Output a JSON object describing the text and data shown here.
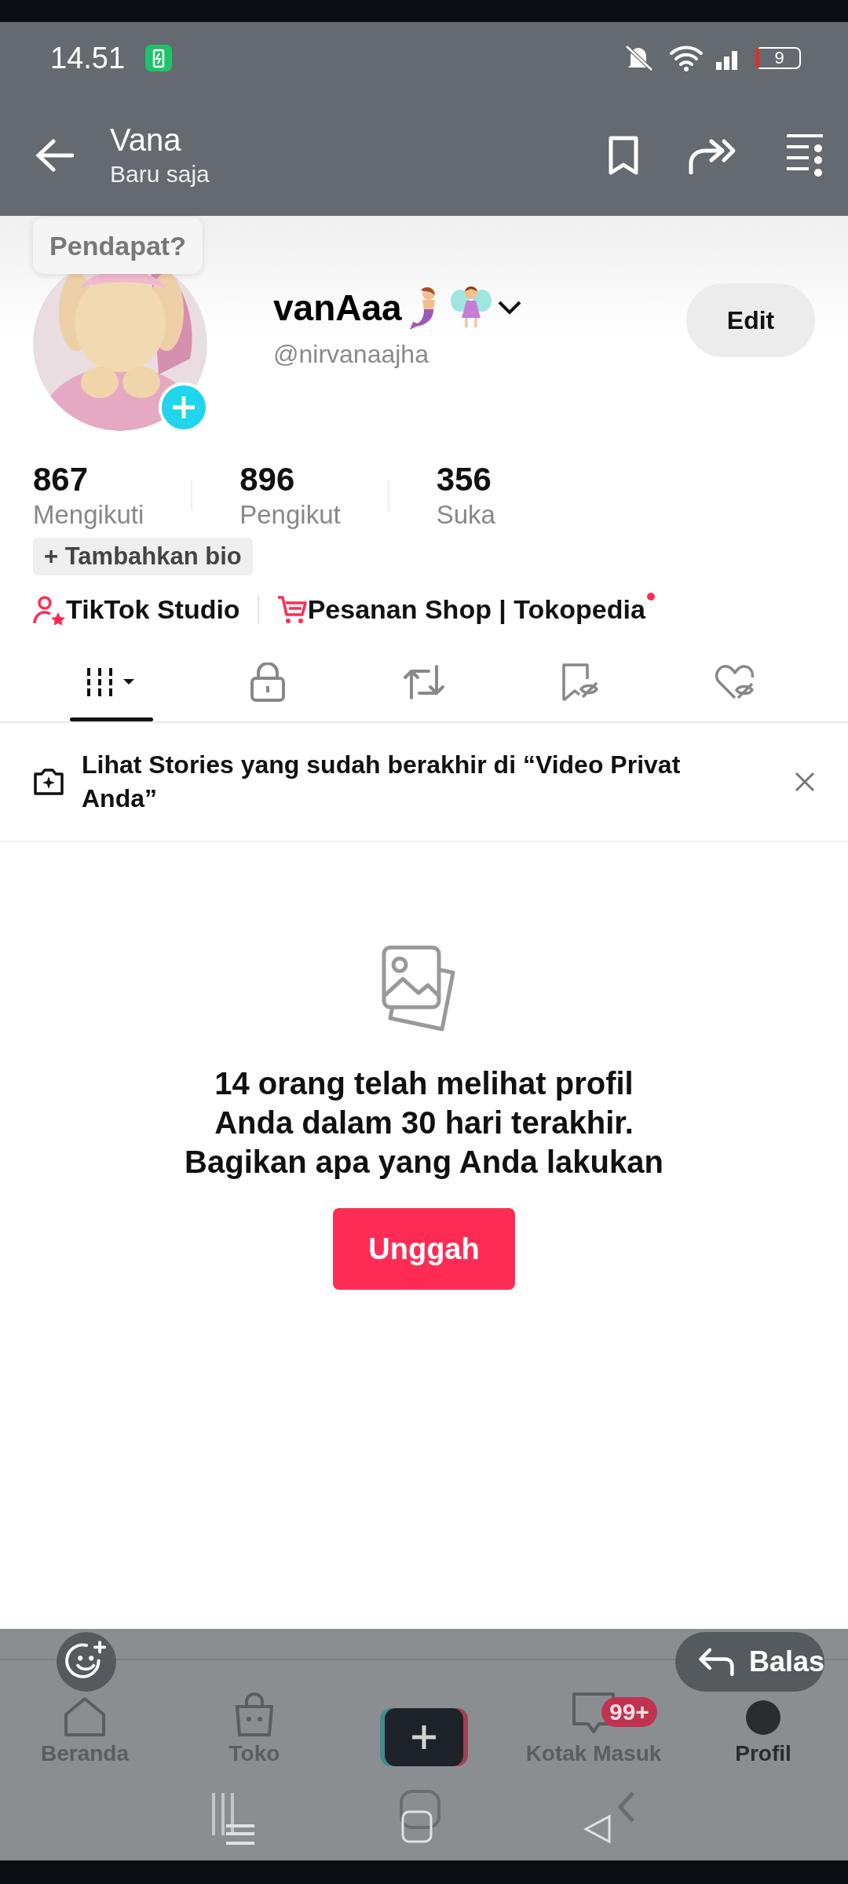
{
  "status_bar": {
    "time": "14.51",
    "battery": "9"
  },
  "header": {
    "title": "Vana",
    "subtitle": "Baru saja"
  },
  "status_content": {
    "tooltip": "Pendapat?",
    "profile": {
      "name": "vanAaa",
      "handle": "@nirvanaajha",
      "edit_button": "Edit"
    },
    "stats": [
      {
        "value": "867",
        "label": "Mengikuti"
      },
      {
        "value": "896",
        "label": "Pengikut"
      },
      {
        "value": "356",
        "label": "Suka"
      }
    ],
    "bio_button": "+ Tambahkan bio",
    "links": [
      {
        "kind": "studio",
        "label": "TikTok Studio",
        "notification": false
      },
      {
        "kind": "shop",
        "label": "Pesanan Shop | Tokopedia",
        "notification": true
      }
    ],
    "tabs": [
      {
        "kind": "grid",
        "selected": true
      },
      {
        "kind": "lock",
        "selected": false
      },
      {
        "kind": "repost",
        "selected": false
      },
      {
        "kind": "saved",
        "selected": false
      },
      {
        "kind": "liked",
        "selected": false
      }
    ],
    "banner": {
      "text": "Lihat Stories yang sudah berakhir di “Video Privat Anda”"
    },
    "empty_state": {
      "lines": [
        "14 orang telah melihat profil",
        "Anda dalam 30 hari terakhir.",
        "Bagikan apa yang Anda lakukan"
      ],
      "button": "Unggah"
    },
    "nav": [
      {
        "kind": "home",
        "label": "Beranda",
        "selected": false
      },
      {
        "kind": "shop",
        "label": "Toko",
        "selected": false
      },
      {
        "kind": "create",
        "selected": false
      },
      {
        "kind": "inbox",
        "label": "Kotak Masuk",
        "badge": "99+",
        "selected": false
      },
      {
        "kind": "profile",
        "label": "Profil",
        "selected": true
      }
    ]
  },
  "reply": {
    "label": "Balas"
  }
}
